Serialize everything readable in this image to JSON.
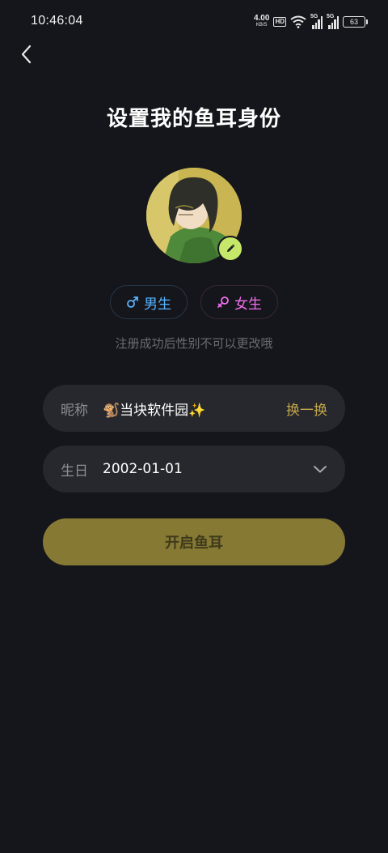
{
  "status_bar": {
    "time": "10:46:04",
    "net_speed": "4.00",
    "net_speed_unit": "KB/S",
    "hd": "HD",
    "sim1_label": "5G",
    "sim2_label": "5G",
    "battery": "63"
  },
  "header": {
    "title": "设置我的鱼耳身份"
  },
  "gender": {
    "male_label": "男生",
    "female_label": "女生",
    "note": "注册成功后性别不可以更改哦"
  },
  "nickname": {
    "label": "昵称",
    "value": "🐒当块软件园✨",
    "refresh_label": "换一换"
  },
  "birthday": {
    "label": "生日",
    "value": "2002-01-01"
  },
  "submit": {
    "label": "开启鱼耳"
  },
  "colors": {
    "background": "#15161b",
    "field_bg": "#27282d",
    "accent_gold": "#c2a64a",
    "button_bg": "#857934",
    "male": "#58b4ff",
    "female": "#f26ff0",
    "edit_badge": "#c6e86a"
  }
}
